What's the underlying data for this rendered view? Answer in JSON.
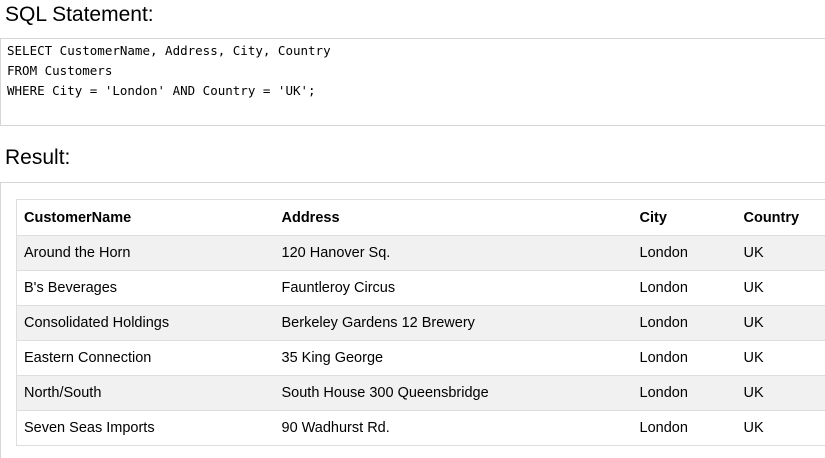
{
  "sql_section": {
    "heading": "SQL Statement:",
    "lines": [
      "SELECT CustomerName, Address, City, Country",
      "FROM Customers",
      "WHERE City = 'London' AND Country = 'UK';"
    ]
  },
  "result_section": {
    "heading": "Result:",
    "columns": [
      "CustomerName",
      "Address",
      "City",
      "Country"
    ],
    "rows": [
      [
        "Around the Horn",
        "120 Hanover Sq.",
        "London",
        "UK"
      ],
      [
        "B's Beverages",
        "Fauntleroy Circus",
        "London",
        "UK"
      ],
      [
        "Consolidated Holdings",
        "Berkeley Gardens 12 Brewery",
        "London",
        "UK"
      ],
      [
        "Eastern Connection",
        "35 King George",
        "London",
        "UK"
      ],
      [
        "North/South",
        "South House 300 Queensbridge",
        "London",
        "UK"
      ],
      [
        "Seven Seas Imports",
        "90 Wadhurst Rd.",
        "London",
        "UK"
      ]
    ]
  },
  "colors": {
    "stripe": "#f1f1f1",
    "border": "#dddddd",
    "box_border": "#d6d6d6"
  }
}
